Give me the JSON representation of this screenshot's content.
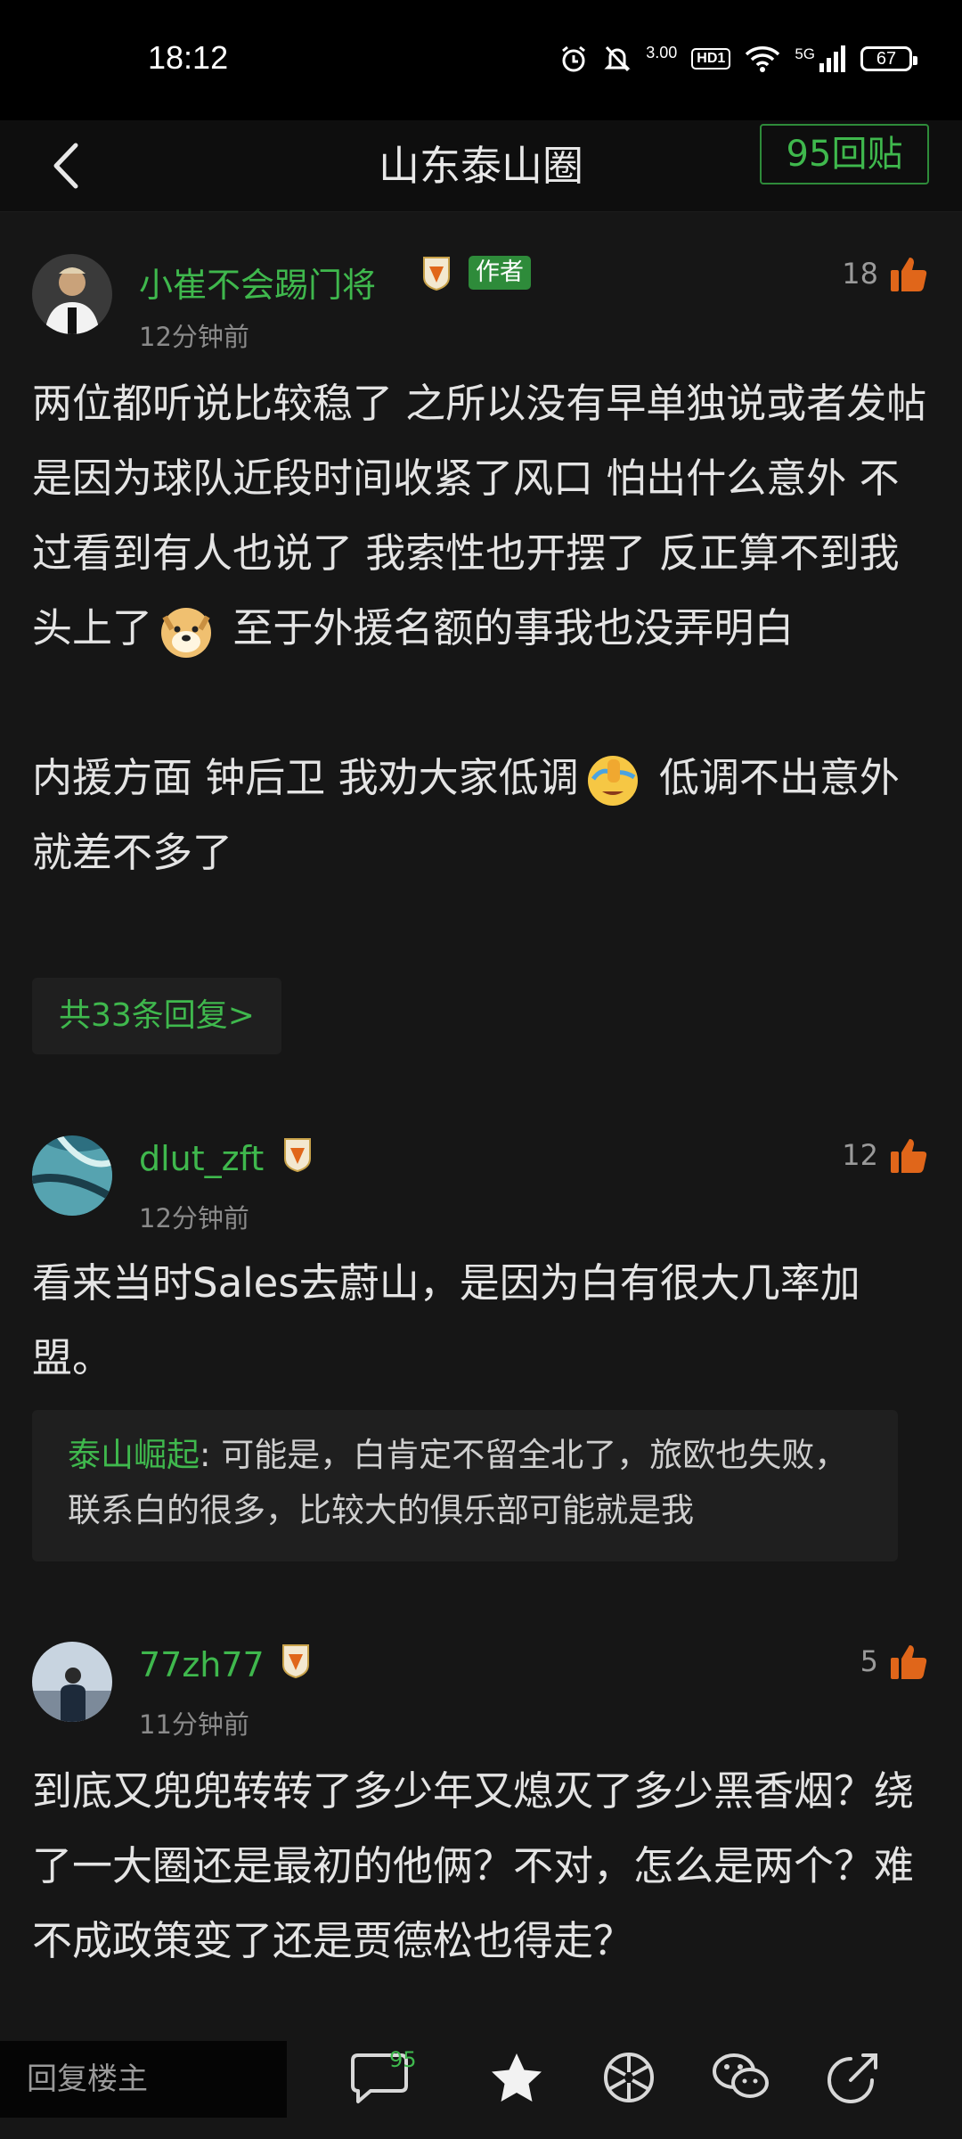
{
  "status": {
    "time": "18:12",
    "net_speed": "3.00",
    "hd": "HD1",
    "signal": "5G",
    "battery": "67"
  },
  "nav": {
    "title": "山东泰山圈",
    "reply_count": "95回贴"
  },
  "comments": [
    {
      "username": "小崔不会踢门将",
      "author_tag": "作者",
      "time": "12分钟前",
      "likes": "18",
      "paragraph1_a": "两位都听说比较稳了 之所以没有早单独说或者发帖是因为球队近段时间收紧了风口 怕出什么意外 不过看到有人也说了 我索性也开摆了 反正算不到我头上了",
      "paragraph1_b": " 至于外援名额的事我也没弄明白",
      "paragraph2_a": "内援方面 钟后卫 我劝大家低调",
      "paragraph2_b": " 低调不出意外就差不多了",
      "more_replies": "共33条回复>"
    },
    {
      "username": "dlut_zft",
      "time": "12分钟前",
      "likes": "12",
      "text": "看来当时Sales去蔚山，是因为白有很大几率加盟。",
      "sub_user": "泰山崛起",
      "sub_text": ": 可能是，白肯定不留全北了，旅欧也失败，联系白的很多，比较大的俱乐部可能就是我"
    },
    {
      "username": "77zh77",
      "time": "11分钟前",
      "likes": "5",
      "text": "到底又兜兜转转了多少年又熄灭了多少黑香烟？绕了一大圈还是最初的他俩？不对，怎么是两个？难不成政策变了还是贾德松也得走？"
    }
  ],
  "bottom": {
    "reply_placeholder": "回复楼主",
    "comment_count": "95"
  },
  "colors": {
    "accent_green": "#3fb84d",
    "background": "#161616"
  }
}
